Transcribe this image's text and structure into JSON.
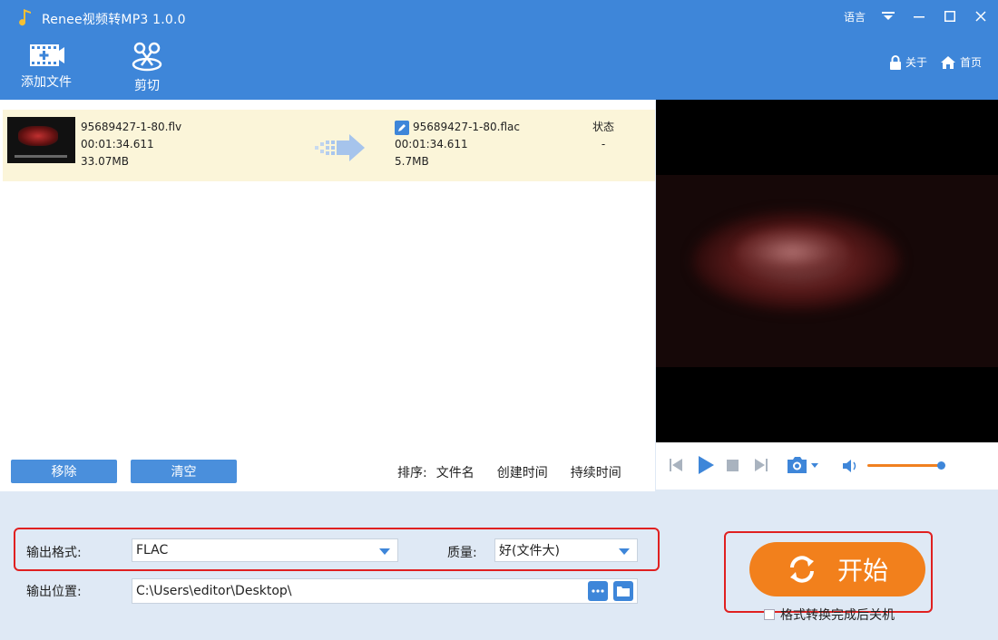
{
  "app": {
    "title": "Renee视频转MP3 1.0.0"
  },
  "window": {
    "language": "语言"
  },
  "toolbar": {
    "add_file": "添加文件",
    "cut": "剪切",
    "about": "关于",
    "home": "首页"
  },
  "file": {
    "source": {
      "name": "95689427-1-80.flv",
      "duration": "00:01:34.611",
      "size": "33.07MB"
    },
    "output": {
      "name": "95689427-1-80.flac",
      "duration": "00:01:34.611",
      "size": "5.7MB"
    },
    "status_header": "状态",
    "status_value": "-"
  },
  "list_actions": {
    "remove": "移除",
    "clear": "清空"
  },
  "sort": {
    "label": "排序:",
    "by_name": "文件名",
    "by_created": "创建时间",
    "by_duration": "持续时间"
  },
  "settings": {
    "format_label": "输出格式:",
    "format_value": "FLAC",
    "quality_label": "质量:",
    "quality_value": "好(文件大)",
    "location_label": "输出位置:",
    "location_value": "C:\\Users\\editor\\Desktop\\"
  },
  "start": {
    "label": "开始",
    "shutdown_label": "格式转换完成后关机"
  },
  "colors": {
    "accent": "#3e86d9",
    "start": "#f2801c",
    "highlight": "#e02020",
    "row_bg": "#fbf5d9"
  }
}
